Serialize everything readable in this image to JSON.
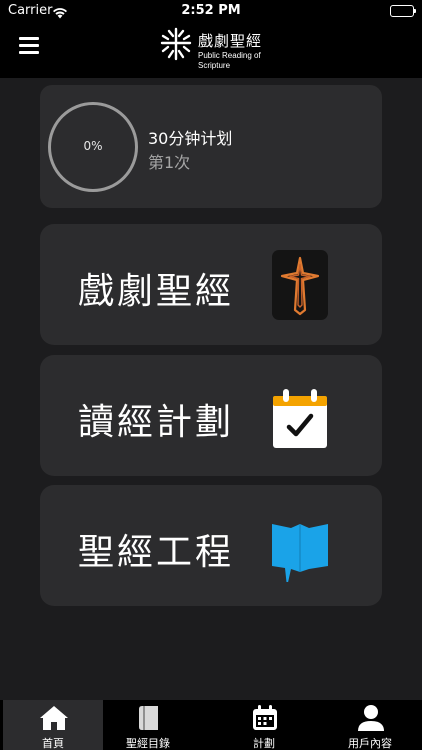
{
  "status_bar": {
    "carrier": "Carrier",
    "time": "2:52 PM"
  },
  "header": {
    "logo_title": "戲劇聖經",
    "logo_subtitle": "Public Reading of Scripture"
  },
  "plan_card": {
    "progress_percent": 0,
    "progress_label": "0%",
    "title": "30分钟计划",
    "subtitle": "第1次"
  },
  "menu": [
    {
      "label": "戲劇聖經",
      "icon": "drama-bible-cross-icon"
    },
    {
      "label": "讀經計劃",
      "icon": "calendar-check-icon"
    },
    {
      "label": "聖經工程",
      "icon": "open-book-map-icon"
    }
  ],
  "tabs": [
    {
      "label": "首頁",
      "icon": "home-icon",
      "active": true
    },
    {
      "label": "聖經目錄",
      "icon": "book-icon",
      "active": false
    },
    {
      "label": "計劃",
      "icon": "calendar-icon",
      "active": false
    },
    {
      "label": "用戶內容",
      "icon": "user-icon",
      "active": false
    }
  ],
  "colors": {
    "background": "#1c1c1e",
    "card": "#2c2c2e",
    "calendar_accent": "#f4a300",
    "book_accent": "#1aa3e8",
    "cross_accent": "#e07a30"
  }
}
